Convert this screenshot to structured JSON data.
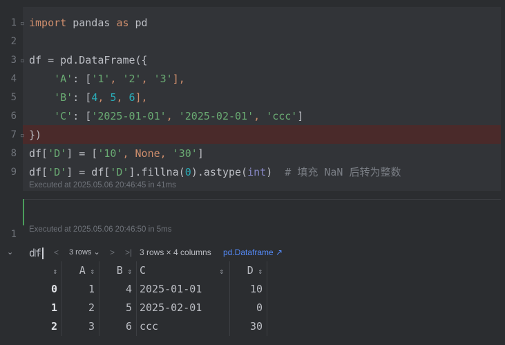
{
  "cell1": {
    "line_numbers": [
      "1",
      "2",
      "3",
      "4",
      "5",
      "6",
      "7",
      "8",
      "9"
    ],
    "lines": [
      [
        {
          "t": "import",
          "c": "kw"
        },
        {
          "t": " pandas ",
          "c": "plain"
        },
        {
          "t": "as",
          "c": "kw"
        },
        {
          "t": " pd",
          "c": "plain"
        }
      ],
      [],
      [
        {
          "t": "df = pd.DataFrame({",
          "c": "plain"
        }
      ],
      [
        {
          "t": "    ",
          "c": "plain"
        },
        {
          "t": "'A'",
          "c": "str"
        },
        {
          "t": ": [",
          "c": "plain"
        },
        {
          "t": "'1'",
          "c": "str"
        },
        {
          "t": ", ",
          "c": "kw"
        },
        {
          "t": "'2'",
          "c": "str"
        },
        {
          "t": ", ",
          "c": "kw"
        },
        {
          "t": "'3'",
          "c": "str"
        },
        {
          "t": "],",
          "c": "kw"
        }
      ],
      [
        {
          "t": "    ",
          "c": "plain"
        },
        {
          "t": "'B'",
          "c": "str"
        },
        {
          "t": ": [",
          "c": "plain"
        },
        {
          "t": "4",
          "c": "num"
        },
        {
          "t": ", ",
          "c": "kw"
        },
        {
          "t": "5",
          "c": "num"
        },
        {
          "t": ", ",
          "c": "kw"
        },
        {
          "t": "6",
          "c": "num"
        },
        {
          "t": "],",
          "c": "kw"
        }
      ],
      [
        {
          "t": "    ",
          "c": "plain"
        },
        {
          "t": "'C'",
          "c": "str"
        },
        {
          "t": ": [",
          "c": "plain"
        },
        {
          "t": "'2025-01-01'",
          "c": "str"
        },
        {
          "t": ", ",
          "c": "kw"
        },
        {
          "t": "'2025-02-01'",
          "c": "str"
        },
        {
          "t": ", ",
          "c": "kw"
        },
        {
          "t": "'ccc'",
          "c": "str"
        },
        {
          "t": "]",
          "c": "plain"
        }
      ],
      [
        {
          "t": "})",
          "c": "plain"
        }
      ],
      [
        {
          "t": "df[",
          "c": "plain"
        },
        {
          "t": "'D'",
          "c": "str"
        },
        {
          "t": "] = [",
          "c": "plain"
        },
        {
          "t": "'10'",
          "c": "str"
        },
        {
          "t": ", ",
          "c": "kw"
        },
        {
          "t": "None",
          "c": "kw"
        },
        {
          "t": ", ",
          "c": "kw"
        },
        {
          "t": "'30'",
          "c": "str"
        },
        {
          "t": "]",
          "c": "plain"
        }
      ],
      [
        {
          "t": "df[",
          "c": "plain"
        },
        {
          "t": "'D'",
          "c": "str"
        },
        {
          "t": "] = df[",
          "c": "plain"
        },
        {
          "t": "'D'",
          "c": "str"
        },
        {
          "t": "].fillna(",
          "c": "plain"
        },
        {
          "t": "0",
          "c": "num"
        },
        {
          "t": ").astype(",
          "c": "plain"
        },
        {
          "t": "int",
          "c": "builtin"
        },
        {
          "t": ")  ",
          "c": "plain"
        },
        {
          "t": "# 填充 NaN 后转为整数",
          "c": "cmt"
        }
      ]
    ],
    "executed": "Executed at 2025.05.06 20:46:45 in 41ms"
  },
  "cell2": {
    "line_number": "1",
    "code": "df",
    "executed": "Executed at 2025.05.06 20:46:50 in 5ms"
  },
  "toolbar": {
    "collapse_icon": "chevron-down-icon",
    "rows_select": "3 rows",
    "summary": "3 rows × 4 columns",
    "link": "pd.Dataframe ↗"
  },
  "table": {
    "headers": [
      "",
      "A",
      "B",
      "C",
      "D"
    ],
    "rows": [
      [
        "0",
        "1",
        "4",
        "2025-01-01",
        "10"
      ],
      [
        "1",
        "2",
        "5",
        "2025-02-01",
        "0"
      ],
      [
        "2",
        "3",
        "6",
        "ccc",
        "30"
      ]
    ]
  },
  "colors": {
    "background": "#2b2d30",
    "keyword": "#cf8e6d",
    "string": "#6aab73",
    "number": "#2aacb8",
    "comment": "#7a7e85",
    "error_line": "#4a2a2a",
    "active_cell_bar": "#4a9d5b",
    "link": "#548af7"
  }
}
